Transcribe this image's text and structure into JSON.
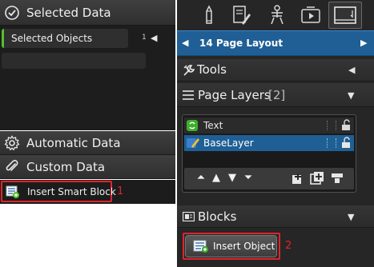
{
  "left_panel": {
    "selected_data": {
      "title": "Selected Data",
      "row_label": "Selected Objects",
      "row_count": "1"
    },
    "automatic_data": {
      "title": "Automatic Data"
    },
    "custom_data": {
      "title": "Custom Data"
    },
    "insert_smart_block": {
      "label": "Insert Smart Block",
      "callout": "1"
    }
  },
  "right_panel": {
    "toolbar": {
      "icons": [
        "pencil-icon",
        "document-edit-icon",
        "presenter-icon",
        "media-icon",
        "page-layout-icon"
      ],
      "active": "page-layout-icon"
    },
    "layout_bar": {
      "label": "14 Page Layout"
    },
    "tools": {
      "title": "Tools"
    },
    "page_layers": {
      "title": "Page Layers",
      "count": "[2]",
      "layers": [
        {
          "name": "Text",
          "icon": "text-layer-icon",
          "selected": false
        },
        {
          "name": "BaseLayer",
          "icon": "base-layer-icon",
          "selected": true
        }
      ]
    },
    "blocks": {
      "title": "Blocks",
      "insert_object_label": "Insert Object",
      "callout": "2"
    }
  },
  "colors": {
    "accent_blue": "#1f5f95",
    "highlight_red": "#e0242a",
    "active_green": "#55c02a"
  }
}
